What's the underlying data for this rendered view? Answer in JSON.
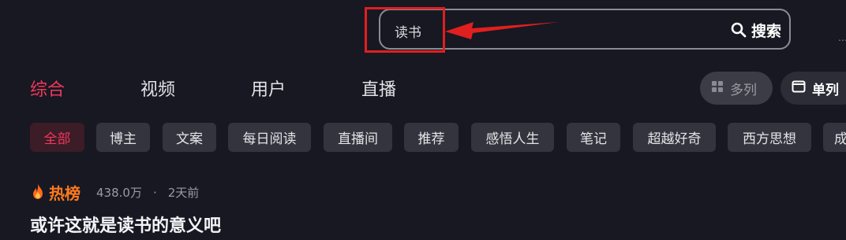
{
  "search": {
    "value": "读书",
    "button_label": "搜索"
  },
  "tabs": [
    {
      "label": "综合"
    },
    {
      "label": "视频"
    },
    {
      "label": "用户"
    },
    {
      "label": "直播"
    }
  ],
  "view_toggle": {
    "multi_label": "多列",
    "single_label": "单列"
  },
  "filters": [
    {
      "label": "全部"
    },
    {
      "label": "博主"
    },
    {
      "label": "文案"
    },
    {
      "label": "每日阅读"
    },
    {
      "label": "直播间"
    },
    {
      "label": "推荐"
    },
    {
      "label": "感悟人生"
    },
    {
      "label": "笔记"
    },
    {
      "label": "超越好奇"
    },
    {
      "label": "西方思想"
    },
    {
      "label": "成"
    }
  ],
  "result": {
    "badge": "热榜",
    "count": "438.0万",
    "separator": "·",
    "time": "2天前",
    "title": "或许这就是读书的意义吧"
  },
  "colors": {
    "background": "#171822",
    "accent": "#f0385b",
    "hot": "#ff7a1e",
    "annotation": "#e01f1f"
  },
  "icons": {
    "search": "search-icon",
    "grid": "grid-icon",
    "single_column": "single-column-icon",
    "flame": "flame-icon"
  }
}
